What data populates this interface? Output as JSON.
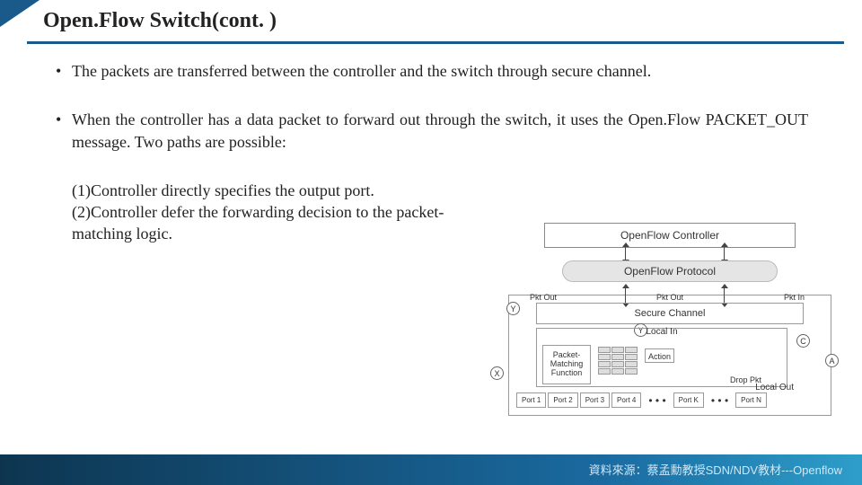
{
  "title": "Open.Flow Switch(cont. )",
  "bullets": [
    "The packets are transferred between the controller and the switch through secure channel.",
    "When the controller has a data packet to forward out through the switch, it uses the Open.Flow PACKET_OUT message. Two paths are possible:"
  ],
  "paths": [
    "(1)Controller directly specifies the output port.",
    "(2)Controller defer the forwarding decision to the packet-matching logic."
  ],
  "diagram": {
    "controller": "OpenFlow Controller",
    "protocol": "OpenFlow Protocol",
    "secure": "Secure Channel",
    "pkt_out": "Pkt Out",
    "pkt_in": "Pkt In",
    "local_in": "Local In",
    "local_out": "Local Out",
    "pmf": "Packet-Matching Function",
    "action": "Action",
    "drop": "Drop Pkt",
    "nodes": {
      "x": "X",
      "y": "Y",
      "a": "A",
      "c": "C"
    },
    "ports": [
      "Port 1",
      "Port 2",
      "Port 3",
      "Port 4",
      "Port K",
      "Port N"
    ]
  },
  "source": "資料來源：蔡孟勳教授SDN/NDV教材---Openflow"
}
